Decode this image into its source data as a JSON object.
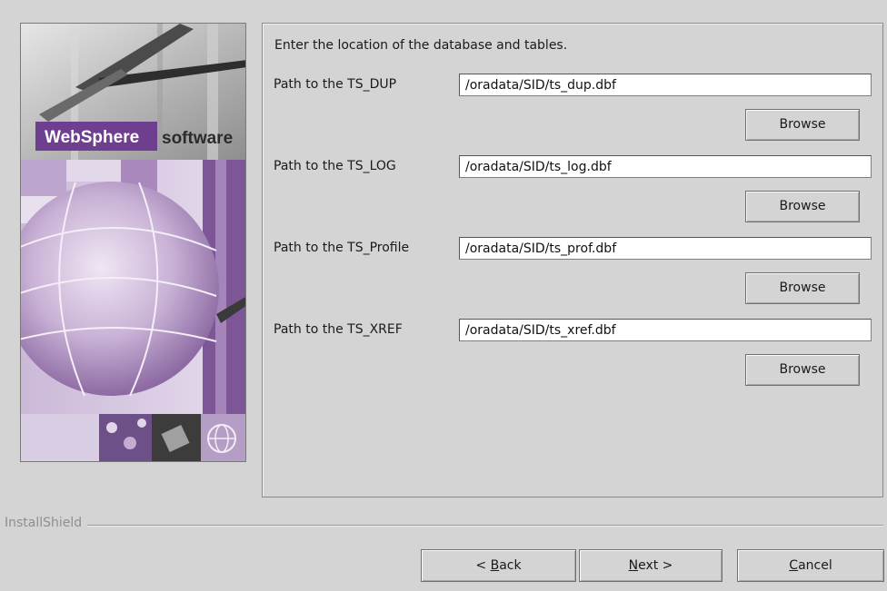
{
  "banner": {
    "brand_name": "WebSphere",
    "brand_suffix": "software"
  },
  "panel": {
    "instruction": "Enter the location of the database and tables.",
    "rows": [
      {
        "label": "Path to the TS_DUP",
        "value": "/oradata/SID/ts_dup.dbf",
        "browse_label": "Browse"
      },
      {
        "label": "Path to the TS_LOG",
        "value": "/oradata/SID/ts_log.dbf",
        "browse_label": "Browse"
      },
      {
        "label": "Path to the TS_Profile",
        "value": "/oradata/SID/ts_prof.dbf",
        "browse_label": "Browse"
      },
      {
        "label": "Path to the TS_XREF",
        "value": "/oradata/SID/ts_xref.dbf",
        "browse_label": "Browse"
      }
    ]
  },
  "footer": {
    "brand": "InstallShield",
    "back": {
      "pre": "< ",
      "mnemonic": "B",
      "post": "ack"
    },
    "next": {
      "pre": "",
      "mnemonic": "N",
      "post": "ext >"
    },
    "cancel": {
      "pre": "",
      "mnemonic": "C",
      "post": "ancel"
    }
  },
  "colors": {
    "background": "#d4d4d4",
    "brand_purple": "#6f3f8f",
    "banner_lavender": "#cfc3d8"
  }
}
